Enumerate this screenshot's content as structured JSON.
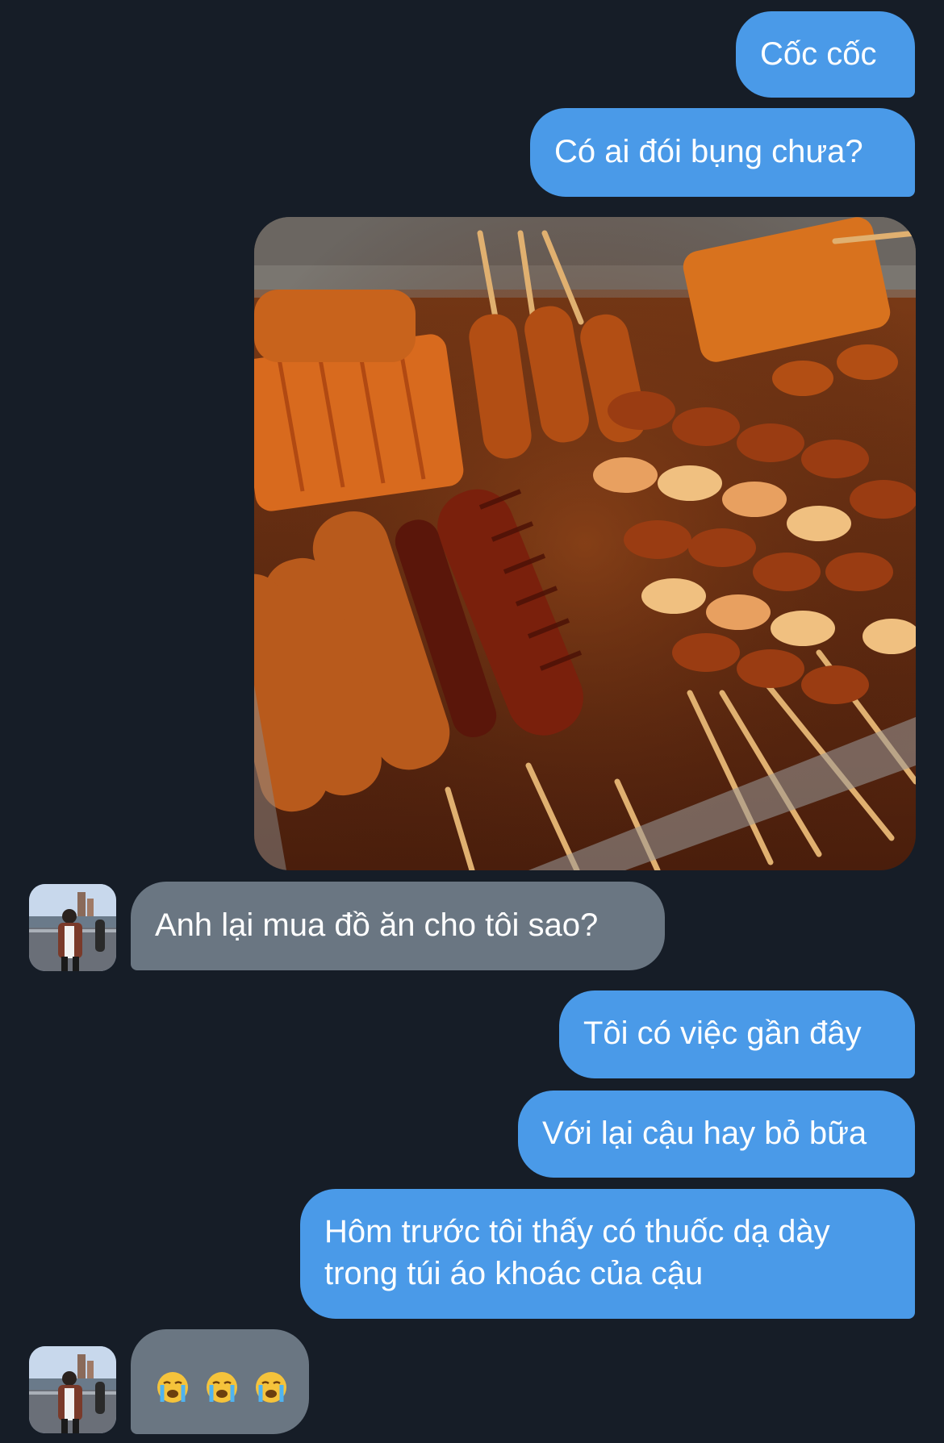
{
  "conversation": {
    "messages": [
      {
        "side": "outgoing",
        "text": "Cốc cốc"
      },
      {
        "side": "outgoing",
        "text": "Có ai đói bụng chưa?"
      },
      {
        "side": "outgoing",
        "type": "photo",
        "icon": "food-photo"
      },
      {
        "side": "incoming",
        "text": "Anh lại mua đồ ăn cho tôi sao?"
      },
      {
        "side": "outgoing",
        "text": "Tôi có việc gần đây"
      },
      {
        "side": "outgoing",
        "text": "Với lại cậu hay bỏ bữa"
      },
      {
        "side": "outgoing",
        "text": "Hôm trước tôi thấy có thuốc dạ dày",
        "text_line2": "trong túi áo khoác của cậu"
      },
      {
        "side": "incoming",
        "text": "😭 😭 😭",
        "icons": [
          "loudly-crying-face-icon",
          "loudly-crying-face-icon",
          "loudly-crying-face-icon"
        ]
      }
    ]
  },
  "colors": {
    "background": "#161d27",
    "outgoing_bubble": "#4a9ae8",
    "incoming_bubble": "#6a7682",
    "text": "#ffffff"
  }
}
